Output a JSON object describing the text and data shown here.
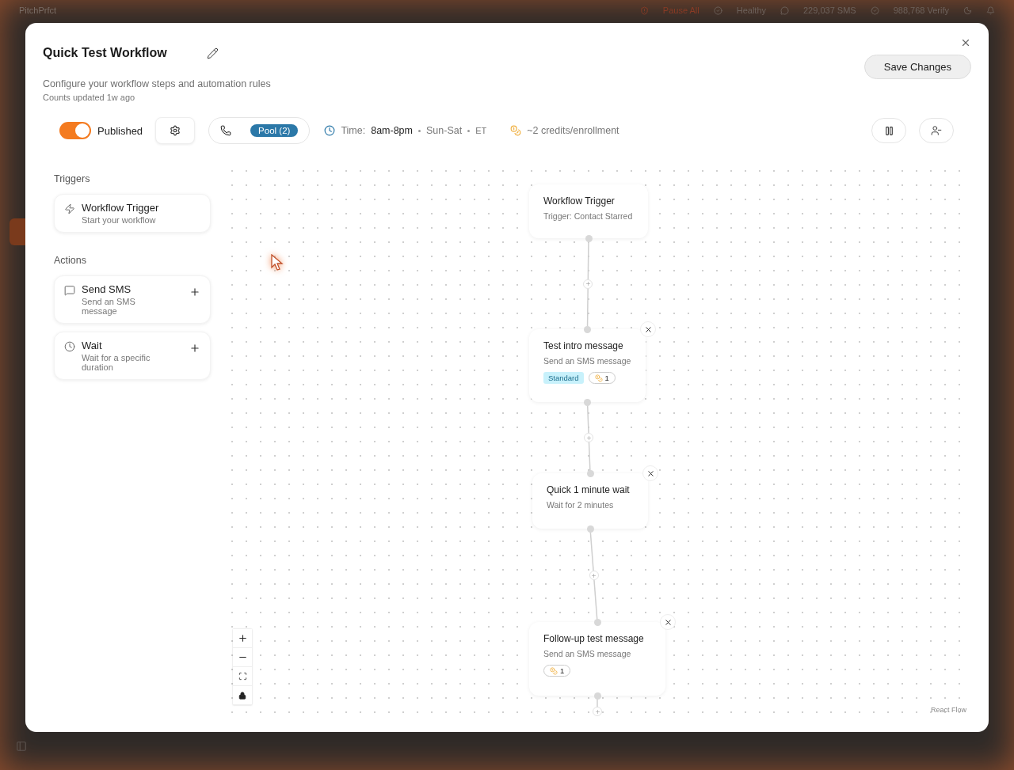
{
  "app_bar": {
    "logo": "PitchPrfct",
    "pause_all": "Pause All",
    "status": "Healthy",
    "sms": "229,037 SMS",
    "verify": "988,768 Verify"
  },
  "modal": {
    "title": "Quick Test Workflow",
    "subtitle": "Configure your workflow steps and automation rules",
    "counts": "Counts updated 1w ago",
    "save": "Save Changes",
    "published": {
      "label": "Published",
      "on": true
    },
    "pool": "Pool (2)",
    "time_label": "Time:",
    "time_value": "8am-8pm",
    "days": "Sun-Sat",
    "tz": "ET",
    "credits": "~2 credits/enrollment"
  },
  "palette": [
    {
      "heading": "Triggers",
      "items": [
        {
          "kind": "trigger",
          "title": "Workflow Trigger",
          "description": "Start your workflow",
          "addable": false
        }
      ]
    },
    {
      "heading": "Actions",
      "items": [
        {
          "kind": "sms",
          "title": "Send SMS",
          "description": "Send an SMS message",
          "addable": true
        },
        {
          "kind": "wait",
          "title": "Wait",
          "description": "Wait for a specific duration",
          "addable": true
        }
      ]
    }
  ],
  "nodes": [
    {
      "kind": "trigger",
      "title": "Workflow Trigger",
      "subtitle": "Trigger: Contact Starred",
      "removable": false
    },
    {
      "kind": "sms",
      "title": "Test intro message",
      "subtitle": "Send an SMS message",
      "removable": true,
      "tags": [
        {
          "kind": "tier",
          "text": "Standard"
        },
        {
          "kind": "credits",
          "text": "1"
        }
      ]
    },
    {
      "kind": "wait",
      "title": "Quick 1 minute wait",
      "subtitle": "Wait for 2 minutes",
      "removable": true
    },
    {
      "kind": "sms",
      "title": "Follow-up test message",
      "subtitle": "Send an SMS message",
      "removable": true,
      "tags": [
        {
          "kind": "credits",
          "text": "1"
        }
      ]
    }
  ],
  "attribution": "React Flow"
}
